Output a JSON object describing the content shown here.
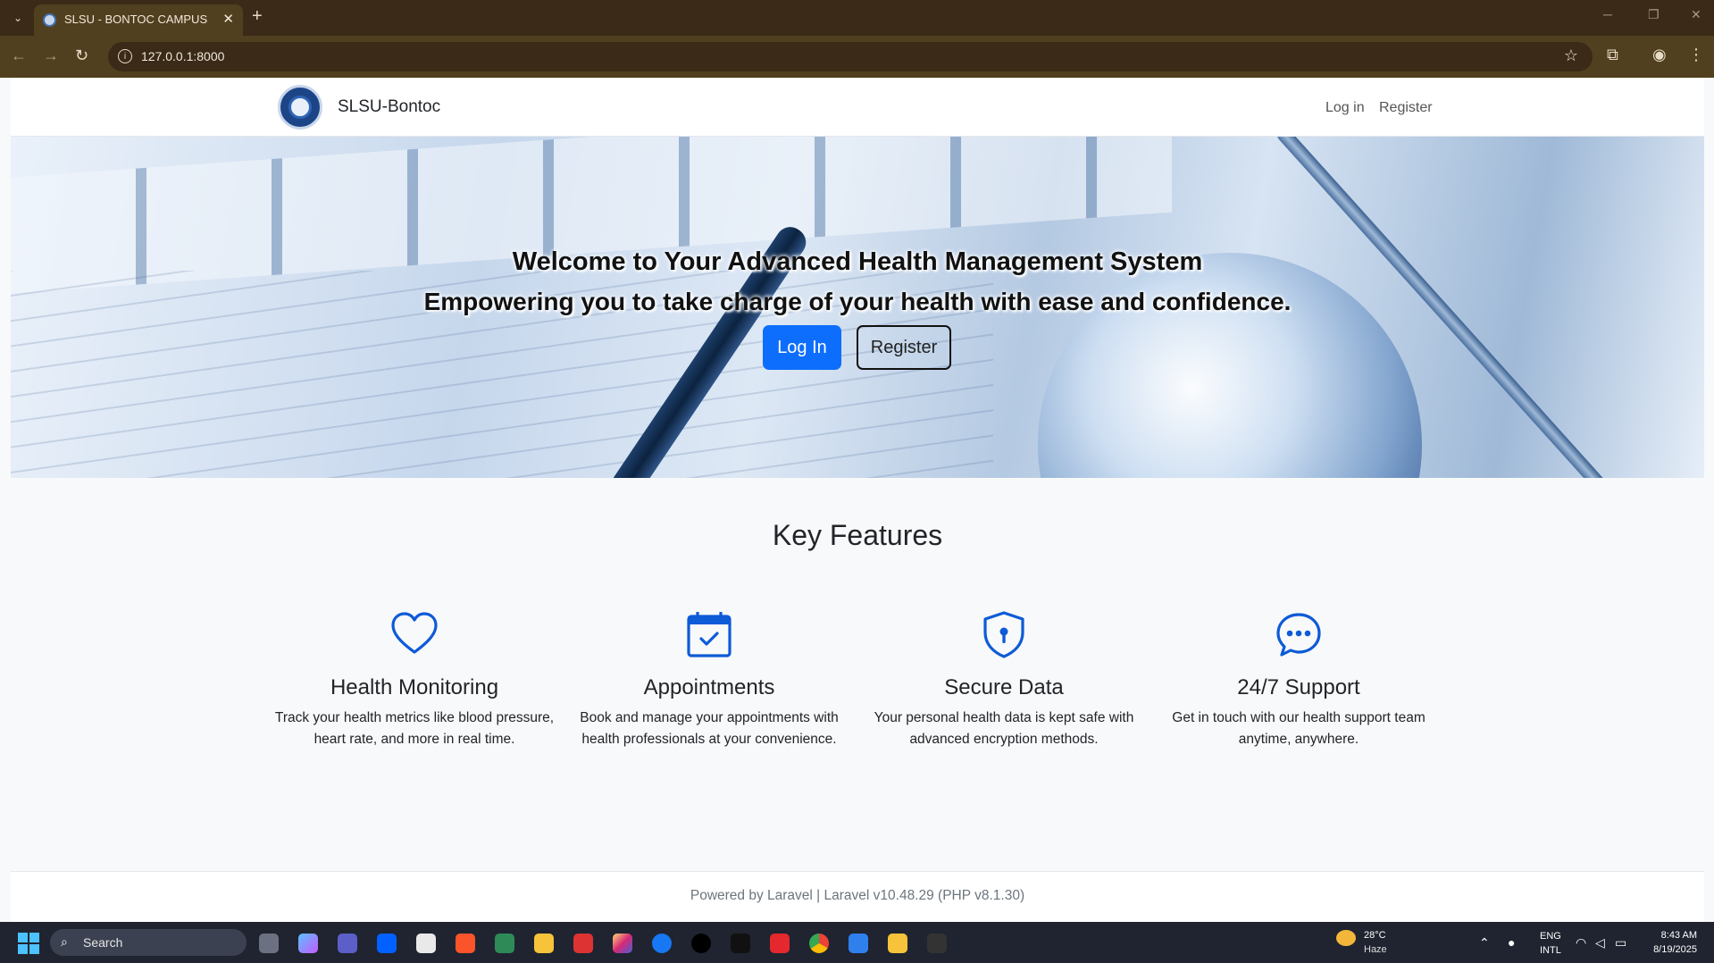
{
  "browser": {
    "tab_title": "SLSU - BONTOC CAMPUS",
    "new_tab": "+",
    "url": "127.0.0.1:8000"
  },
  "navbar": {
    "brand": "SLSU-Bontoc",
    "login": "Log in",
    "register": "Register"
  },
  "hero": {
    "title": "Welcome to Your Advanced Health Management System",
    "subtitle": "Empowering you to take charge of your health with ease and confidence.",
    "login_button": "Log In",
    "register_button": "Register"
  },
  "features": {
    "title": "Key Features",
    "items": [
      {
        "name": "Health Monitoring",
        "description": "Track your health metrics like blood pressure, heart rate, and more in real time.",
        "icon": "heart-icon"
      },
      {
        "name": "Appointments",
        "description": "Book and manage your appointments with health professionals at your convenience.",
        "icon": "calendar-check-icon"
      },
      {
        "name": "Secure Data",
        "description": "Your personal health data is kept safe with advanced encryption methods.",
        "icon": "shield-lock-icon"
      },
      {
        "name": "24/7 Support",
        "description": "Get in touch with our health support team anytime, anywhere.",
        "icon": "chat-dots-icon"
      }
    ]
  },
  "footer": {
    "text": "Powered by Laravel | Laravel v10.48.29 (PHP v8.1.30)"
  },
  "taskbar": {
    "search_label": "Search",
    "weather_temp": "28°C",
    "weather_desc": "Haze",
    "lang_1": "ENG",
    "lang_2": "INTL",
    "time": "8:43 AM",
    "date": "8/19/2025"
  },
  "colors": {
    "primary": "#0d6efd",
    "icon_blue": "#0d5bd7",
    "browser_frame": "#3a2a17"
  }
}
